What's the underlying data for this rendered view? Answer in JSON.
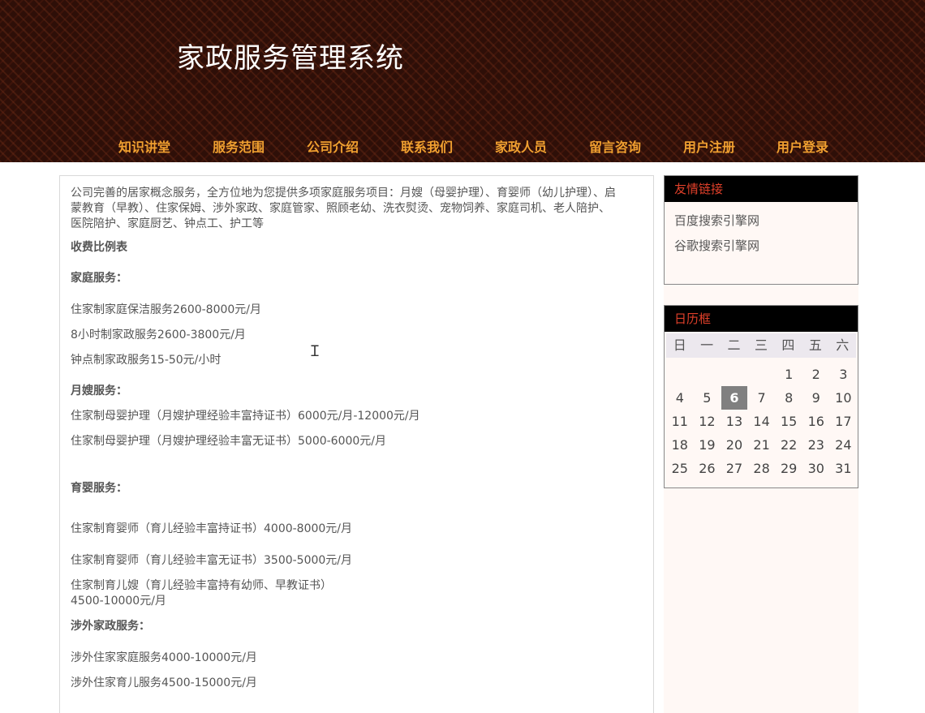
{
  "header": {
    "title": "家政服务管理系统",
    "nav": [
      "知识讲堂",
      "服务范围",
      "公司介绍",
      "联系我们",
      "家政人员",
      "留言咨询",
      "用户注册",
      "用户登录"
    ]
  },
  "main": {
    "intro": "公司完善的居家概念服务，全方位地为您提供多项家庭服务项目：月嫂（母婴护理）、育婴师（幼儿护理）、启蒙教育（早教）、住家保姆、涉外家政、家庭管家、照顾老幼、洗衣熨烫、宠物饲养、家庭司机、老人陪护、医院陪护、家庭厨艺、钟点工、护工等",
    "fee_title": "收费比例表",
    "home_title": "家庭服务：",
    "home_lines": [
      "住家制家庭保洁服务2600-8000元/月",
      "8小时制家政服务2600-3800元/月",
      "钟点制家政服务15-50元/小时"
    ],
    "maternity_title": "月嫂服务：",
    "maternity_lines": [
      "住家制母婴护理（月嫂护理经验丰富持证书）6000元/月-12000元/月",
      "住家制母婴护理（月嫂护理经验丰富无证书）5000-6000元/月"
    ],
    "nursery_title": "育婴服务：",
    "nursery_lines": [
      "住家制育婴师（育儿经验丰富持证书）4000-8000元/月",
      "住家制育婴师（育儿经验丰富无证书）3500-5000元/月",
      "住家制育儿嫂（育儿经验丰富持有幼师、早教证书）",
      "4500-10000元/月"
    ],
    "foreign_title": "涉外家政服务：",
    "foreign_lines": [
      "涉外住家家庭服务4000-10000元/月",
      "涉外住家育儿服务4500-15000元/月"
    ]
  },
  "links_panel": {
    "title": "友情链接",
    "items": [
      "百度搜索引擎网",
      "谷歌搜索引擎网"
    ]
  },
  "calendar": {
    "title": "日历框",
    "weekdays": [
      "日",
      "一",
      "二",
      "三",
      "四",
      "五",
      "六"
    ],
    "lead_blanks": 4,
    "days": [
      1,
      2,
      3,
      4,
      5,
      6,
      7,
      8,
      9,
      10,
      11,
      12,
      13,
      14,
      15,
      16,
      17,
      18,
      19,
      20,
      21,
      22,
      23,
      24,
      25,
      26,
      27,
      28,
      29,
      30,
      31
    ],
    "today": 6
  }
}
